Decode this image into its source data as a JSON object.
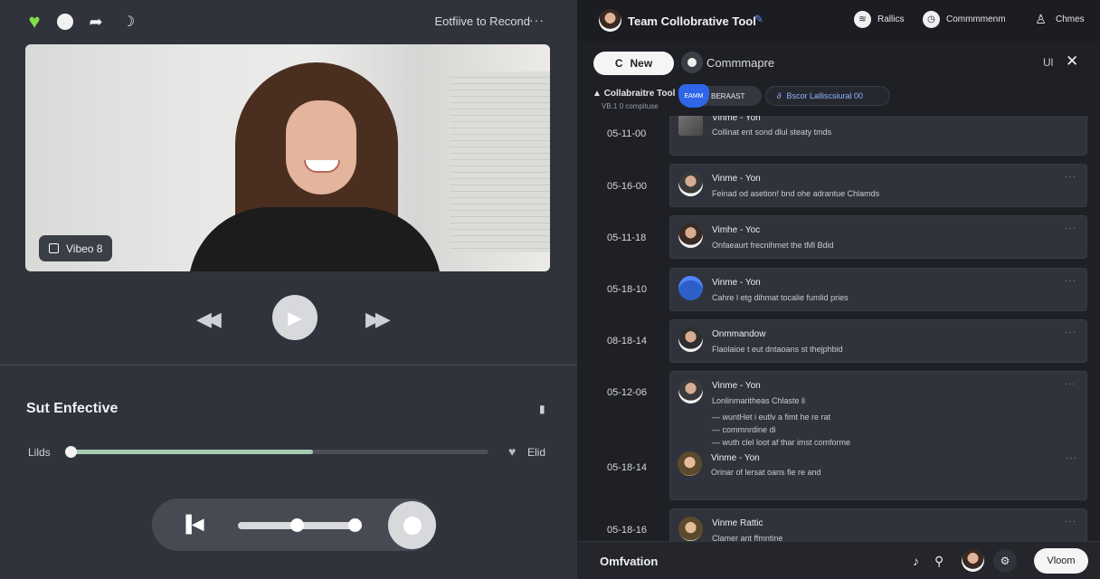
{
  "player": {
    "top_right_label": "Eotfiive to Recond",
    "top_right_more": "···",
    "video_tag": "Vibeo 8",
    "section_title": "Sut Enfective",
    "progress": {
      "left_label": "Lilds",
      "right_label": "Elid",
      "value": 0.58
    }
  },
  "panel": {
    "title": "Team Collobrative Tool",
    "top_items": [
      {
        "icon": "wifi-icon",
        "label": "Rallics"
      },
      {
        "icon": "clock-icon",
        "label": "Commmmenm"
      },
      {
        "icon": "user-icon",
        "label": "Chmes"
      }
    ],
    "new_button": "New",
    "compose_label": "Commmapre",
    "ui_label": "Ul",
    "subheader": {
      "title": "Collabraitre Tool",
      "caption": "VB.1 0 compituse"
    },
    "chip_blue": {
      "pin": "EAMM",
      "label": "BERAAST"
    },
    "chip_dark": "Bscor Lalliscsiural 00",
    "entries": [
      {
        "time": "05-11-00",
        "name": "Vinme - Yon",
        "lines": [
          "Collinat ent sond dlul steaty tmds"
        ]
      },
      {
        "time": "05-16-00",
        "name": "Vinme - Yon",
        "lines": [
          "Feinad od asetion! bnd ohe adrantue Chlamds"
        ]
      },
      {
        "time": "05-11-18",
        "name": "Vimhe - Yoc",
        "lines": [
          "Onfaeaurt frecnihmet the tMl Bdid"
        ]
      },
      {
        "time": "05-18-10",
        "name": "Vinme - Yon",
        "lines": [
          "Cahre l etg dihmat tocalie fumlid pries"
        ]
      },
      {
        "time": "08-18-14",
        "name": "Onmmandow",
        "lines": [
          "Flaolaioe t eut dntaoans st thejphbid"
        ]
      },
      {
        "time": "05-12-06",
        "name": "Vinme - Yon",
        "lines": [
          "Lonlinmaritheas Chlaste li",
          "— wuntHet i eutlv a fimt he re rat",
          "— commnrdine di",
          "— wuth clel loot af thar imst comforme"
        ]
      },
      {
        "time": "05-18-14",
        "name": "Vinme - Yon",
        "lines": [
          "Orinar of lersat oans fie re and"
        ]
      },
      {
        "time": "05-18-16",
        "name": "Vinme Rattic",
        "lines": [
          "Clamer ant ffmntine"
        ]
      }
    ],
    "footer": {
      "label": "Omfvation",
      "button": "Vloom"
    }
  }
}
